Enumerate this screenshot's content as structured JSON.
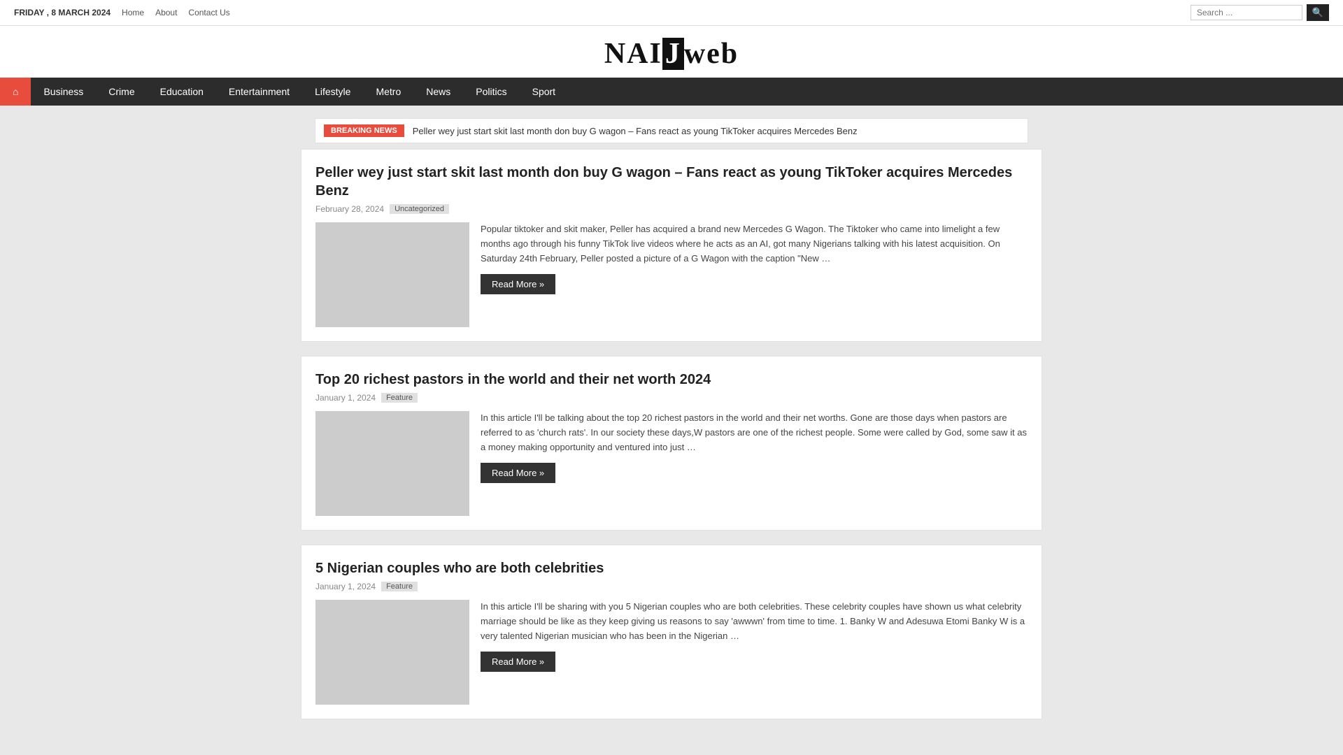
{
  "topbar": {
    "date": "FRIDAY , 8 MARCH 2024",
    "nav_links": [
      {
        "label": "Home",
        "active": true
      },
      {
        "label": "About"
      },
      {
        "label": "Contact Us"
      }
    ],
    "search_placeholder": "Search ..."
  },
  "logo": {
    "part1": "NAI",
    "part2": "J",
    "part3": "web"
  },
  "navbar": {
    "home_icon": "⌂",
    "links": [
      {
        "label": "Business"
      },
      {
        "label": "Crime"
      },
      {
        "label": "Education"
      },
      {
        "label": "Entertainment"
      },
      {
        "label": "Lifestyle"
      },
      {
        "label": "Metro"
      },
      {
        "label": "News"
      },
      {
        "label": "Politics"
      },
      {
        "label": "Sport"
      }
    ]
  },
  "breaking_news": {
    "label": "BREAKING NEWS",
    "text": "Peller wey just start skit last month don buy G wagon – Fans react as young TikToker acquires Mercedes Benz"
  },
  "articles": [
    {
      "title": "Peller wey just start skit last month don buy G wagon – Fans react as young TikToker acquires Mercedes Benz",
      "date": "February 28, 2024",
      "category": "Uncategorized",
      "excerpt": "Popular tiktoker and skit maker, Peller has acquired a brand new Mercedes G Wagon. The Tiktoker who came into limelight a few months ago through his funny TikTok live videos where he acts as an AI, got many Nigerians talking with his latest acquisition. On Saturday 24th February, Peller posted a picture of a G Wagon with the caption \"New …",
      "read_more": "Read More »"
    },
    {
      "title": "Top 20 richest pastors in the world and their net worth 2024",
      "date": "January 1, 2024",
      "category": "Feature",
      "excerpt": "In this article I'll be talking about the top 20 richest pastors in the world and their net worths. Gone are those days when pastors are referred to as 'church rats'. In our society these days,W pastors are one of the richest people. Some were called by God, some saw it as a money making opportunity and ventured into just …",
      "read_more": "Read More »"
    },
    {
      "title": "5 Nigerian couples who are both celebrities",
      "date": "January 1, 2024",
      "category": "Feature",
      "excerpt": "In this article I'll be sharing with you 5 Nigerian couples who are both celebrities. These celebrity couples have shown us what celebrity marriage should be like as they keep giving us reasons to say 'awwwn' from time to time. 1. Banky W and Adesuwa Etomi Banky W is a very talented Nigerian musician who has been in the Nigerian …",
      "read_more": "Read More »"
    }
  ],
  "colors": {
    "accent_red": "#e74c3c",
    "nav_dark": "#2c2c2c",
    "btn_dark": "#333"
  }
}
